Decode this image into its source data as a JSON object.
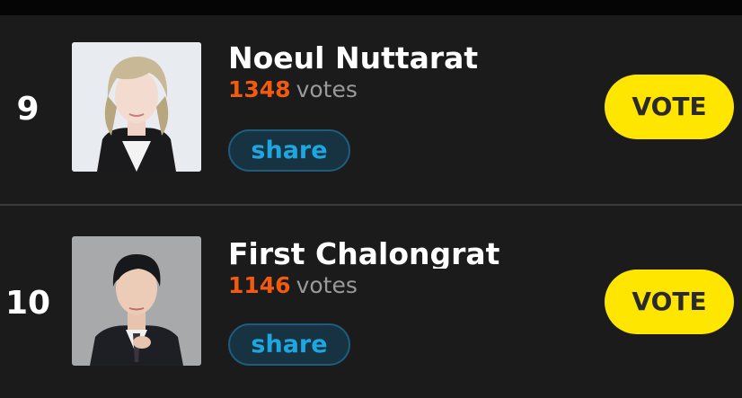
{
  "colors": {
    "background": "#1b1b1b",
    "vote_count": "#f25a0f",
    "votes_unit": "#9a9a9a",
    "vote_button": "#ffe600",
    "share_text": "#1ea6e0",
    "share_border": "#1e5c7d"
  },
  "entries": [
    {
      "rank": "9",
      "name": "Noeul Nuttarat",
      "votes": "1348",
      "votes_unit": "votes",
      "share_label": "share",
      "vote_label": "VOTE",
      "avatar_icon": "portrait-photo"
    },
    {
      "rank": "10",
      "name": "First Chalongrat",
      "votes": "1146",
      "votes_unit": "votes",
      "share_label": "share",
      "vote_label": "VOTE",
      "avatar_icon": "portrait-photo"
    }
  ]
}
